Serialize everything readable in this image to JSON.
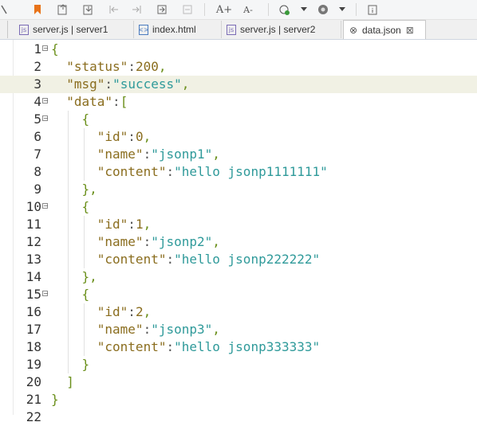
{
  "toolbar": {
    "icons": [
      "bookmark-icon",
      "import-icon",
      "export-icon",
      "step-back-icon",
      "step-forward-icon",
      "insert-icon",
      "disabled-icon",
      "font-increase-icon",
      "font-decrease-icon",
      "run-icon",
      "dropdown-icon",
      "browser-icon",
      "dropdown-icon",
      "info-icon"
    ],
    "font_increase_label": "A+",
    "font_decrease_label": "A-"
  },
  "tabs": [
    {
      "label": "server.js | server1",
      "icon": "js-file-icon",
      "active": false
    },
    {
      "label": "index.html",
      "icon": "html-file-icon",
      "active": false
    },
    {
      "label": "server.js | server2",
      "icon": "js-file-icon",
      "active": false
    },
    {
      "label": "data.json",
      "icon": "json-file-icon",
      "active": true,
      "close": "⊠"
    }
  ],
  "editor": {
    "highlighted_line": 3,
    "lines": [
      {
        "n": "1",
        "fold": true,
        "segments": [
          [
            "p",
            "{"
          ]
        ]
      },
      {
        "n": "2",
        "fold": false,
        "segments": [
          [
            "k",
            "\"status\""
          ],
          [
            "c",
            ":"
          ],
          [
            "n",
            "200"
          ],
          [
            "p",
            ","
          ]
        ]
      },
      {
        "n": "3",
        "fold": false,
        "segments": [
          [
            "k",
            "\"msg\""
          ],
          [
            "c",
            ":"
          ],
          [
            "s",
            "\"success\""
          ],
          [
            "p",
            ","
          ]
        ]
      },
      {
        "n": "4",
        "fold": true,
        "segments": [
          [
            "k",
            "\"data\""
          ],
          [
            "c",
            ":"
          ],
          [
            "p",
            "["
          ]
        ]
      },
      {
        "n": "5",
        "fold": true,
        "segments": [
          [
            "p",
            "{"
          ]
        ]
      },
      {
        "n": "6",
        "fold": false,
        "segments": [
          [
            "k",
            "\"id\""
          ],
          [
            "c",
            ":"
          ],
          [
            "n",
            "0"
          ],
          [
            "p",
            ","
          ]
        ]
      },
      {
        "n": "7",
        "fold": false,
        "segments": [
          [
            "k",
            "\"name\""
          ],
          [
            "c",
            ":"
          ],
          [
            "s",
            "\"jsonp1\""
          ],
          [
            "p",
            ","
          ]
        ]
      },
      {
        "n": "8",
        "fold": false,
        "segments": [
          [
            "k",
            "\"content\""
          ],
          [
            "c",
            ":"
          ],
          [
            "s",
            "\"hello jsonp1111111\""
          ]
        ]
      },
      {
        "n": "9",
        "fold": false,
        "segments": [
          [
            "p",
            "},"
          ]
        ]
      },
      {
        "n": "10",
        "fold": true,
        "segments": [
          [
            "p",
            "{"
          ]
        ]
      },
      {
        "n": "11",
        "fold": false,
        "segments": [
          [
            "k",
            "\"id\""
          ],
          [
            "c",
            ":"
          ],
          [
            "n",
            "1"
          ],
          [
            "p",
            ","
          ]
        ]
      },
      {
        "n": "12",
        "fold": false,
        "segments": [
          [
            "k",
            "\"name\""
          ],
          [
            "c",
            ":"
          ],
          [
            "s",
            "\"jsonp2\""
          ],
          [
            "p",
            ","
          ]
        ]
      },
      {
        "n": "13",
        "fold": false,
        "segments": [
          [
            "k",
            "\"content\""
          ],
          [
            "c",
            ":"
          ],
          [
            "s",
            "\"hello jsonp222222\""
          ]
        ]
      },
      {
        "n": "14",
        "fold": false,
        "segments": [
          [
            "p",
            "},"
          ]
        ]
      },
      {
        "n": "15",
        "fold": true,
        "segments": [
          [
            "p",
            "{"
          ]
        ]
      },
      {
        "n": "16",
        "fold": false,
        "segments": [
          [
            "k",
            "\"id\""
          ],
          [
            "c",
            ":"
          ],
          [
            "n",
            "2"
          ],
          [
            "p",
            ","
          ]
        ]
      },
      {
        "n": "17",
        "fold": false,
        "segments": [
          [
            "k",
            "\"name\""
          ],
          [
            "c",
            ":"
          ],
          [
            "s",
            "\"jsonp3\""
          ],
          [
            "p",
            ","
          ]
        ]
      },
      {
        "n": "18",
        "fold": false,
        "segments": [
          [
            "k",
            "\"content\""
          ],
          [
            "c",
            ":"
          ],
          [
            "s",
            "\"hello jsonp333333\""
          ]
        ]
      },
      {
        "n": "19",
        "fold": false,
        "segments": [
          [
            "p",
            "}"
          ]
        ]
      },
      {
        "n": "20",
        "fold": false,
        "segments": [
          [
            "p",
            "]"
          ]
        ]
      },
      {
        "n": "21",
        "fold": false,
        "segments": [
          [
            "p",
            "}"
          ]
        ]
      },
      {
        "n": "22",
        "fold": false,
        "segments": []
      }
    ]
  }
}
